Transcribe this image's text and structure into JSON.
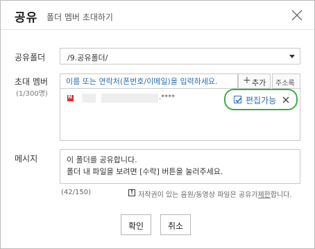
{
  "dialog": {
    "title": "공유",
    "subtitle": "폴더 멤버 초대하기"
  },
  "folder": {
    "label": "공유폴더",
    "selected": "/9.공유폴더/"
  },
  "invite": {
    "label": "초대 멤버",
    "limit": "(1/300명)",
    "placeholder": "이름 또는 연락처(폰번호/이메일)을 입력하세요.",
    "add_label": "추가",
    "addressbook_label": "주소록"
  },
  "members": [
    {
      "service_icon": "N",
      "email_suffix": ".****",
      "permission_label": "편집가능",
      "permission_checked": true
    }
  ],
  "message": {
    "label": "메시지",
    "lines": [
      "이 폴더를 공유합니다.",
      "폴더 내 파일을 보려면 [수락] 버튼을 눌러주세요."
    ],
    "count": "(42/150)"
  },
  "notice": {
    "icon": "!",
    "text": "저작권이 있는 음원/동영상 파일은 공유가",
    "link": "제한",
    "suffix": "합니다."
  },
  "buttons": {
    "confirm": "확인",
    "cancel": "취소"
  },
  "colors": {
    "accent_blue": "#2a6db5",
    "highlight_green": "#3eab45",
    "naver_red": "#d9302b"
  },
  "icons": {
    "close": "close-icon",
    "dropdown": "chevron-down-icon",
    "add": "plus-icon",
    "service": "naver-icon",
    "checkbox": "checkbox-checked-icon",
    "remove": "close-icon",
    "warning": "warning-icon"
  }
}
